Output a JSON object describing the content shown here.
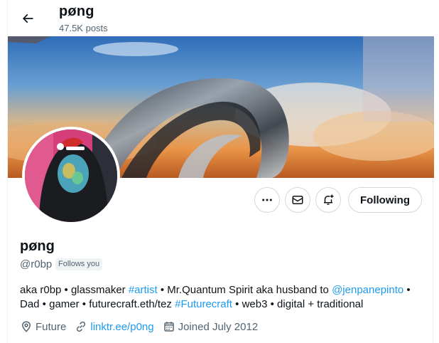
{
  "header": {
    "title": "pøng",
    "posts_count": "47.5K posts"
  },
  "actions": {
    "more_icon": "more-horizontal-icon",
    "message_icon": "envelope-icon",
    "notify_icon": "bell-plus-icon",
    "follow_label": "Following"
  },
  "profile": {
    "display_name": "pøng",
    "handle": "@r0bp",
    "follows_you": "Follows you",
    "bio": {
      "part1": "aka r0bp • glassmaker ",
      "tag1": "#artist",
      "part2": " • Mr.Quantum Spirit aka husband to ",
      "tag2": "@jenpanepinto",
      "part3": " • Dad • gamer • futurecraft.eth/tez ",
      "tag3": "#Futurecraft",
      "part4": " • web3 • digital + traditional"
    },
    "location": "Future",
    "website": "linktr.ee/p0ng",
    "joined": "Joined July 2012"
  },
  "colors": {
    "accent": "#1d9bf0",
    "text_primary": "#0f1419",
    "text_secondary": "#536471",
    "border": "#cfd9de"
  }
}
